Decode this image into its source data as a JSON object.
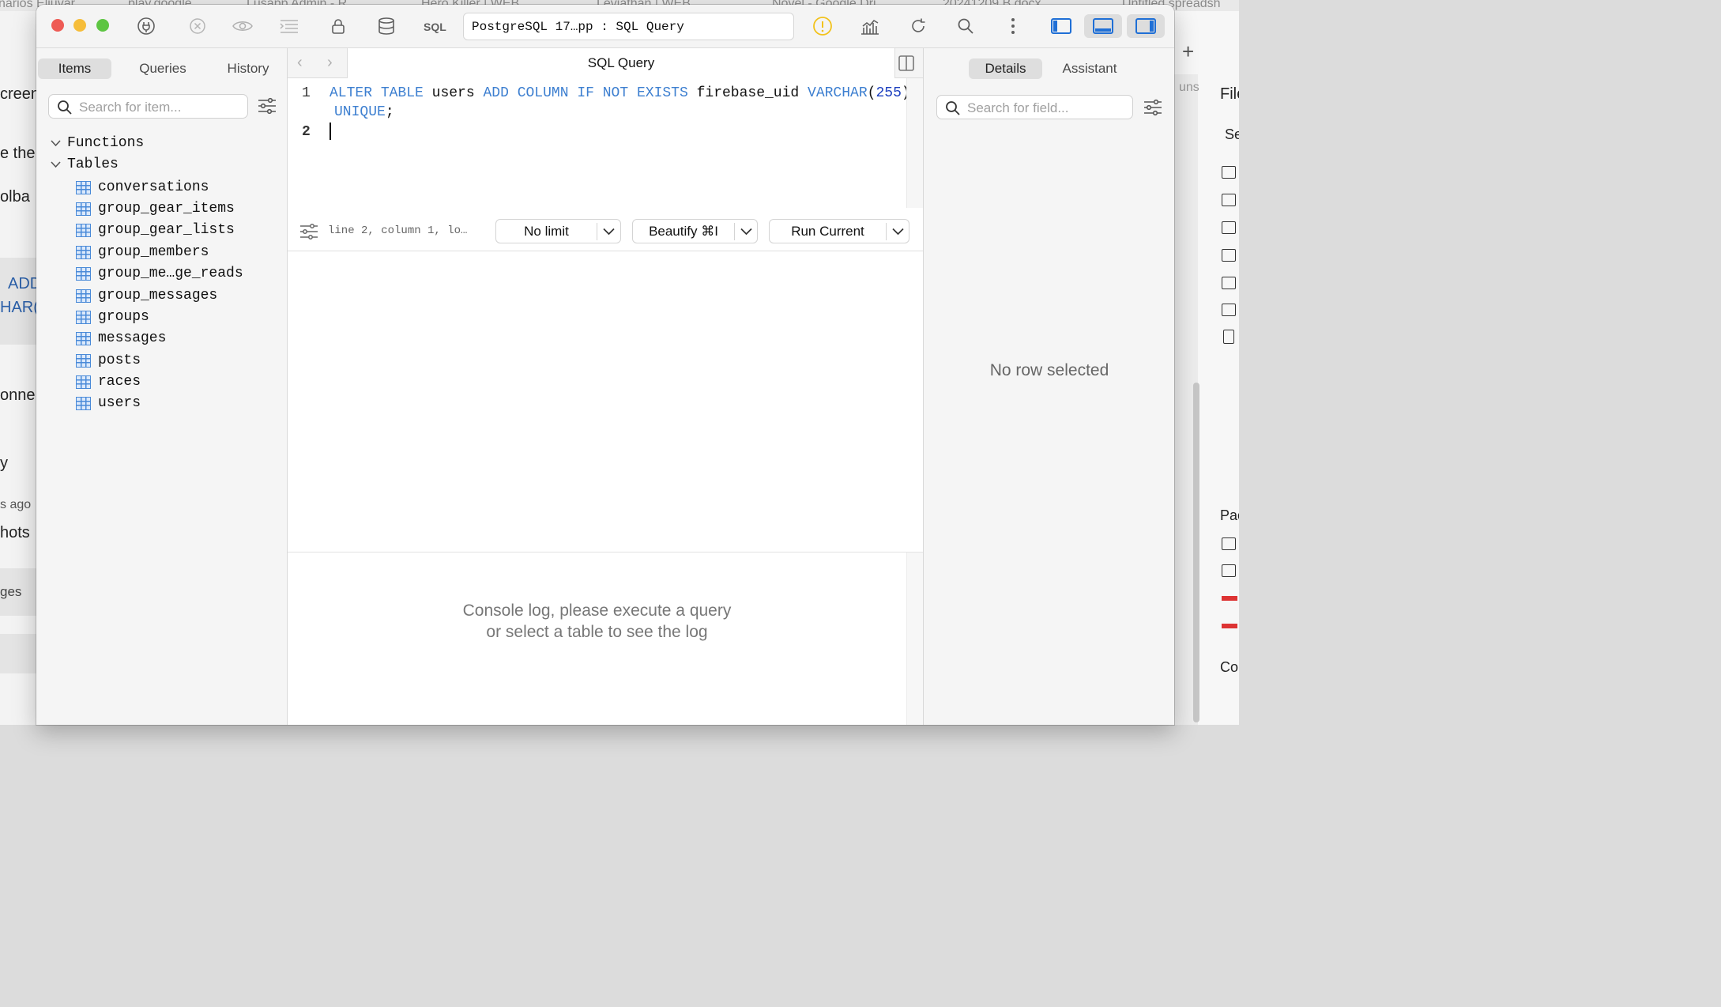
{
  "background": {
    "browser_tabs": [
      "narios Eliuvar",
      "play.google",
      "Lusapp Admin - R",
      "Hero Killer | WEB",
      "Leviathan | WEB",
      "Novel - Google Dri",
      "20241209.B.docx",
      "Untitled spreadsh"
    ],
    "left_fragments": [
      "creen",
      "e the",
      "olba",
      "ADD",
      "HAR(",
      "onne",
      "y",
      "s ago",
      "hots",
      "ges"
    ],
    "right_fragments": [
      "uns",
      "File",
      "Se",
      "Pac",
      "Cor"
    ]
  },
  "toolbar": {
    "sql_label": "SQL",
    "connection": "PostgreSQL 17…pp : SQL Query"
  },
  "sidebar": {
    "tabs": [
      "Items",
      "Queries",
      "History"
    ],
    "search_placeholder": "Search for item...",
    "groups": [
      "Functions",
      "Tables"
    ],
    "tables": [
      "conversations",
      "group_gear_items",
      "group_gear_lists",
      "group_members",
      "group_me…ge_reads",
      "group_messages",
      "groups",
      "messages",
      "posts",
      "races",
      "users"
    ]
  },
  "editor": {
    "tab_title": "SQL Query",
    "line_numbers": [
      "1",
      "2"
    ],
    "tokens": {
      "alter": "ALTER",
      "table": "TABLE",
      "users": "users",
      "add": "ADD",
      "column": "COLUMN",
      "if": "IF",
      "not": "NOT",
      "exists": "EXISTS",
      "field": "firebase_uid",
      "type": "VARCHAR",
      "open": "(",
      "len": "255",
      "close": ")",
      "unique": "UNIQUE",
      "semi": ";"
    },
    "status": "line 2, column 1, lo…",
    "limit_label": "No limit",
    "beautify_label": "Beautify ⌘I",
    "run_label": "Run Current"
  },
  "console": {
    "line1": "Console log, please execute a query",
    "line2": "or select a table to see the log"
  },
  "right_panel": {
    "tabs": [
      "Details",
      "Assistant"
    ],
    "search_placeholder": "Search for field...",
    "empty_text": "No row selected"
  },
  "colors": {
    "keyword": "#3d7fd0",
    "number": "#1c3fbf",
    "close_light": "#ee5b55",
    "minimize_light": "#f6bd3a",
    "zoom_light": "#5dc542",
    "warning": "#f2c21b",
    "layout_active": "#1f6fd6"
  }
}
